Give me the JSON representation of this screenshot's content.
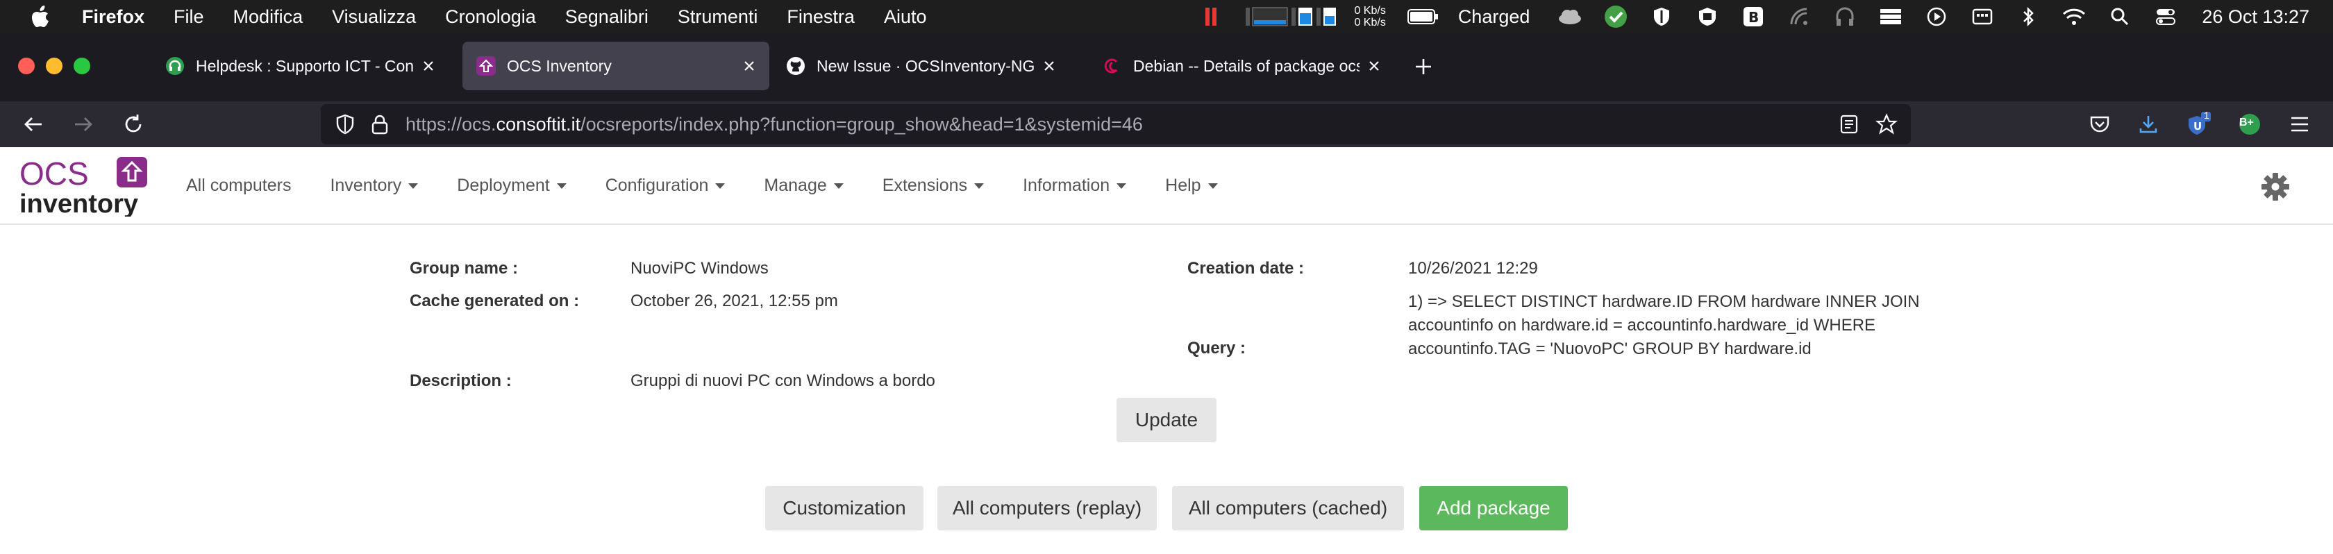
{
  "menubar": {
    "app_name": "Firefox",
    "items": [
      "File",
      "Modifica",
      "Visualizza",
      "Cronologia",
      "Segnalibri",
      "Strumenti",
      "Finestra",
      "Aiuto"
    ],
    "net_up": "0 Kb/s",
    "net_down": "0 Kb/s",
    "battery_status": "Charged",
    "clock": "26 Oct  13:27"
  },
  "tabs": [
    {
      "title": "Helpdesk : Supporto ICT - Consoft",
      "favicon": "headset-icon",
      "active": false
    },
    {
      "title": "OCS Inventory",
      "favicon": "ocs-icon",
      "active": true
    },
    {
      "title": "New Issue · OCSInventory-NG/OCS",
      "favicon": "github-icon",
      "active": false
    },
    {
      "title": "Debian -- Details of package ocs",
      "favicon": "debian-icon",
      "active": false
    }
  ],
  "urlbar": {
    "prefix": "https://ocs.",
    "host": "consoftit.it",
    "path": "/ocsreports/index.php?function=group_show&head=1&systemid=46"
  },
  "toolbar": {
    "extension_badge": "1",
    "avatar_label": "B+"
  },
  "ocs": {
    "logo_top": "OCS",
    "logo_bottom": "inventory",
    "nav": [
      "All computers",
      "Inventory",
      "Deployment",
      "Configuration",
      "Manage",
      "Extensions",
      "Information",
      "Help"
    ],
    "nav_has_caret": [
      false,
      true,
      true,
      true,
      true,
      true,
      true,
      true
    ]
  },
  "group": {
    "name_label": "Group name :",
    "name_value": "NuoviPC Windows",
    "cache_label": "Cache generated on :",
    "cache_value": "October 26, 2021, 12:55 pm",
    "description_label": "Description :",
    "description_value": "Gruppi di nuovi PC con Windows a bordo",
    "creation_label": "Creation date :",
    "creation_value": "10/26/2021 12:29",
    "query_label": "Query :",
    "query_lines": [
      "1) => SELECT DISTINCT hardware.ID FROM hardware INNER JOIN",
      "accountinfo on hardware.id = accountinfo.hardware_id WHERE",
      "accountinfo.TAG = 'NuovoPC' GROUP BY hardware.id"
    ],
    "update_label": "Update"
  },
  "actions": {
    "customization": "Customization",
    "replay": "All computers (replay)",
    "cached": "All computers (cached)",
    "add_package": "Add package"
  },
  "colors": {
    "ocs_purple": "#8a2c8a",
    "success_green": "#5cb85c",
    "firefox_dark": "#1c1b22"
  }
}
